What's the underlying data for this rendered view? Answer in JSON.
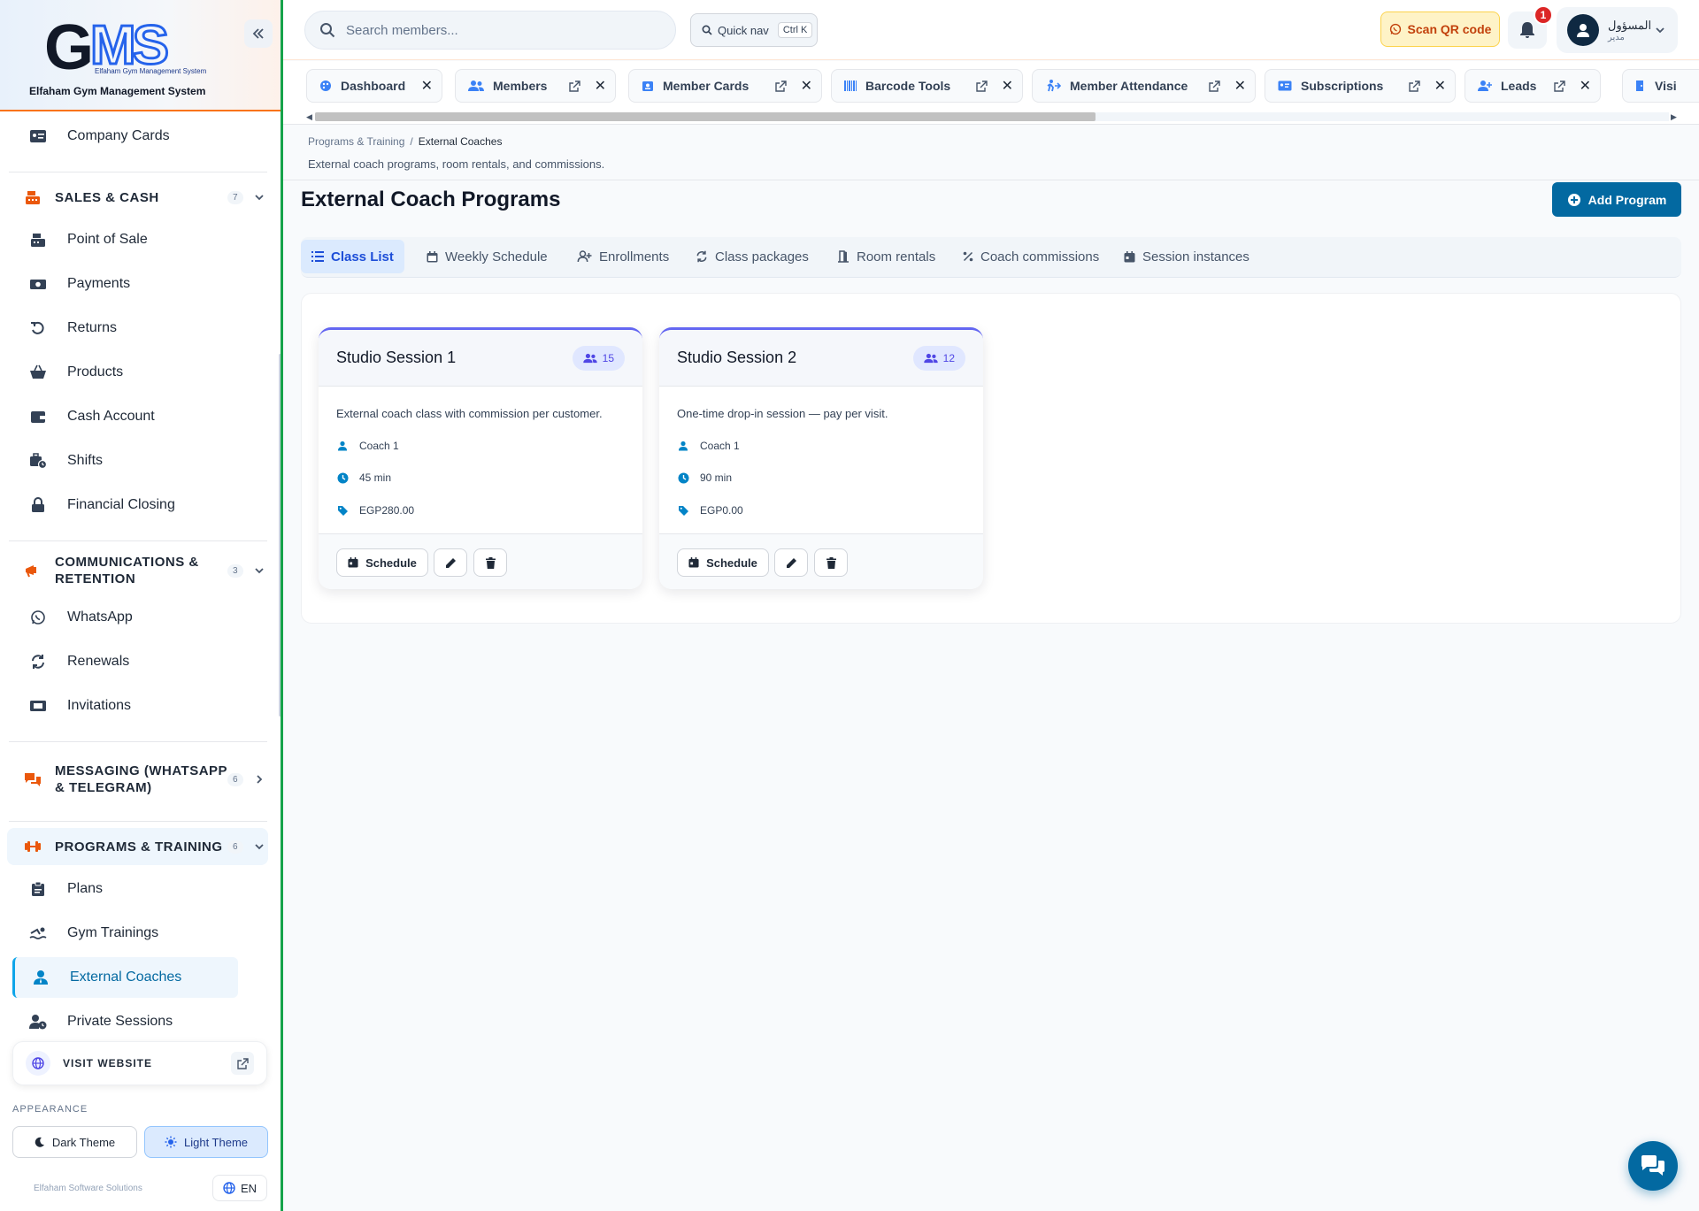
{
  "app": {
    "logo_text": "GMS",
    "logo_sub": "Elfaham Gym Management System",
    "name": "Elfaham Gym Management System",
    "accent": "#0369a1",
    "brand_orange": "#ea580c"
  },
  "sidebar": {
    "top_items": [
      {
        "label": "Company Cards",
        "icon": "id-card-icon"
      }
    ],
    "sales_section": {
      "label": "SALES & CASH",
      "count": "7",
      "icon": "cash-register-icon"
    },
    "sales_items": [
      {
        "label": "Point of Sale",
        "icon": "cash-register-icon"
      },
      {
        "label": "Payments",
        "icon": "money-bill-icon"
      },
      {
        "label": "Returns",
        "icon": "undo-icon"
      },
      {
        "label": "Products",
        "icon": "basket-icon"
      },
      {
        "label": "Cash Account",
        "icon": "wallet-icon"
      },
      {
        "label": "Shifts",
        "icon": "business-time-icon"
      },
      {
        "label": "Financial Closing",
        "icon": "lock-icon"
      }
    ],
    "comms_section": {
      "label": "COMMUNICATIONS & RETENTION",
      "count": "3",
      "icon": "bullhorn-icon"
    },
    "comms_items": [
      {
        "label": "WhatsApp",
        "icon": "whatsapp-icon"
      },
      {
        "label": "Renewals",
        "icon": "sync-icon"
      },
      {
        "label": "Invitations",
        "icon": "ticket-icon"
      }
    ],
    "messaging_section": {
      "label": "MESSAGING (WHATSAPP & TELEGRAM)",
      "count": "6",
      "icon": "comments-icon"
    },
    "programs_section": {
      "label": "PROGRAMS & TRAINING",
      "count": "6",
      "icon": "dumbbell-icon"
    },
    "programs_items": [
      {
        "label": "Plans",
        "icon": "clipboard-icon"
      },
      {
        "label": "Gym Trainings",
        "icon": "swimmer-icon"
      },
      {
        "label": "External Coaches",
        "icon": "user-tie-icon"
      },
      {
        "label": "Private Sessions",
        "icon": "user-clock-icon"
      }
    ],
    "visit_website": "VISIT WEBSITE",
    "appearance_label": "APPEARANCE",
    "dark_theme": "Dark Theme",
    "light_theme": "Light Theme",
    "footer_brand": "Elfaham Software Solutions",
    "language": "EN"
  },
  "topbar": {
    "search_placeholder": "Search members...",
    "quick_nav": "Quick nav",
    "quick_nav_shortcut": "Ctrl K",
    "scan_qr": "Scan QR code",
    "notifications_count": "1",
    "user_name": "المسؤول",
    "user_role": "مدير"
  },
  "open_tabs": [
    {
      "label": "Dashboard",
      "icon": "palette-icon"
    },
    {
      "label": "Members",
      "icon": "users-icon"
    },
    {
      "label": "Member Cards",
      "icon": "id-badge-icon"
    },
    {
      "label": "Barcode Tools",
      "icon": "barcode-icon"
    },
    {
      "label": "Member Attendance",
      "icon": "walking-icon"
    },
    {
      "label": "Subscriptions",
      "icon": "id-card-icon"
    },
    {
      "label": "Leads",
      "icon": "user-plus-icon"
    },
    {
      "label": "Visi",
      "icon": "door-icon"
    }
  ],
  "page": {
    "breadcrumb_parent": "Programs & Training",
    "breadcrumb_current": "External Coaches",
    "description": "External coach programs, room rentals, and commissions.",
    "title": "External Coach Programs",
    "add_button": "Add Program"
  },
  "sub_tabs": [
    {
      "label": "Class List",
      "icon": "list-icon",
      "active": true
    },
    {
      "label": "Weekly Schedule",
      "icon": "calendar-icon",
      "active": false
    },
    {
      "label": "Enrollments",
      "icon": "user-plus-icon",
      "active": false
    },
    {
      "label": "Class packages",
      "icon": "sync-icon",
      "active": false
    },
    {
      "label": "Room rentals",
      "icon": "door-open-icon",
      "active": false
    },
    {
      "label": "Coach commissions",
      "icon": "percent-icon",
      "active": false
    },
    {
      "label": "Session instances",
      "icon": "calendar-day-icon",
      "active": false
    }
  ],
  "programs": [
    {
      "title": "Studio Session 1",
      "capacity": "15",
      "description": "External coach class with commission per customer.",
      "coach": "Coach 1",
      "duration": "45 min",
      "price": "EGP280.00",
      "schedule_label": "Schedule"
    },
    {
      "title": "Studio Session 2",
      "capacity": "12",
      "description": "One-time drop-in session — pay per visit.",
      "coach": "Coach 1",
      "duration": "90 min",
      "price": "EGP0.00",
      "schedule_label": "Schedule"
    }
  ]
}
